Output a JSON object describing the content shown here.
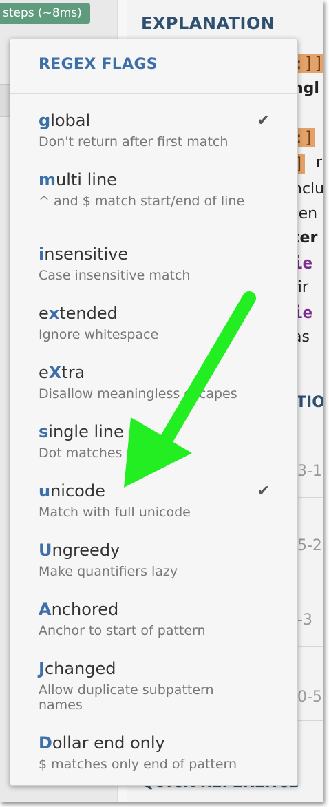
{
  "background": {
    "steps_badge": "steps (~8ms)",
    "explanation_title": "EXPLANATION",
    "quick_reference_title": "QUICK REFERENCE",
    "section_title": "TIO",
    "code_lines": [
      ":]]",
      "ngl",
      ":]",
      "]",
      "r",
      "nclu",
      "ten",
      "ter",
      "ie",
      "fir",
      "ie",
      "as"
    ],
    "row_numbers": [
      "3-1",
      "5-2",
      "-3",
      "0-5"
    ]
  },
  "menu": {
    "title": "REGEX FLAGS",
    "flags": [
      {
        "key": "g",
        "rest": "lobal",
        "desc": "Don't return after first match",
        "checked": true
      },
      {
        "key": "m",
        "rest": "ulti line",
        "desc": "^ and $ match start/end of line",
        "checked": false
      },
      {
        "key": "i",
        "rest": "nsensitive",
        "desc": "Case insensitive match",
        "checked": false
      },
      {
        "prefix": "e",
        "key": "x",
        "rest": "tended",
        "desc": "Ignore whitespace",
        "checked": false
      },
      {
        "prefix": "e",
        "key": "X",
        "rest": "tra",
        "desc": "Disallow meaningless escapes",
        "checked": false
      },
      {
        "key": "s",
        "rest": "ingle line",
        "desc": "Dot matches newline",
        "checked": false
      },
      {
        "key": "u",
        "rest": "nicode",
        "desc": "Match with full unicode",
        "checked": true
      },
      {
        "key": "U",
        "rest": "ngreedy",
        "desc": "Make quantifiers lazy",
        "checked": false
      },
      {
        "key": "A",
        "rest": "nchored",
        "desc": "Anchor to start of pattern",
        "checked": false
      },
      {
        "key": "J",
        "rest": "changed",
        "desc": "Allow duplicate subpattern names",
        "checked": false
      },
      {
        "key": "D",
        "rest": "ollar end only",
        "desc": "$ matches only end of pattern",
        "checked": false
      }
    ],
    "check_glyph": "✔"
  },
  "colors": {
    "flag_key": "#3d6fa8",
    "arrow": "#22ee22",
    "badge": "#5f9b7d"
  }
}
